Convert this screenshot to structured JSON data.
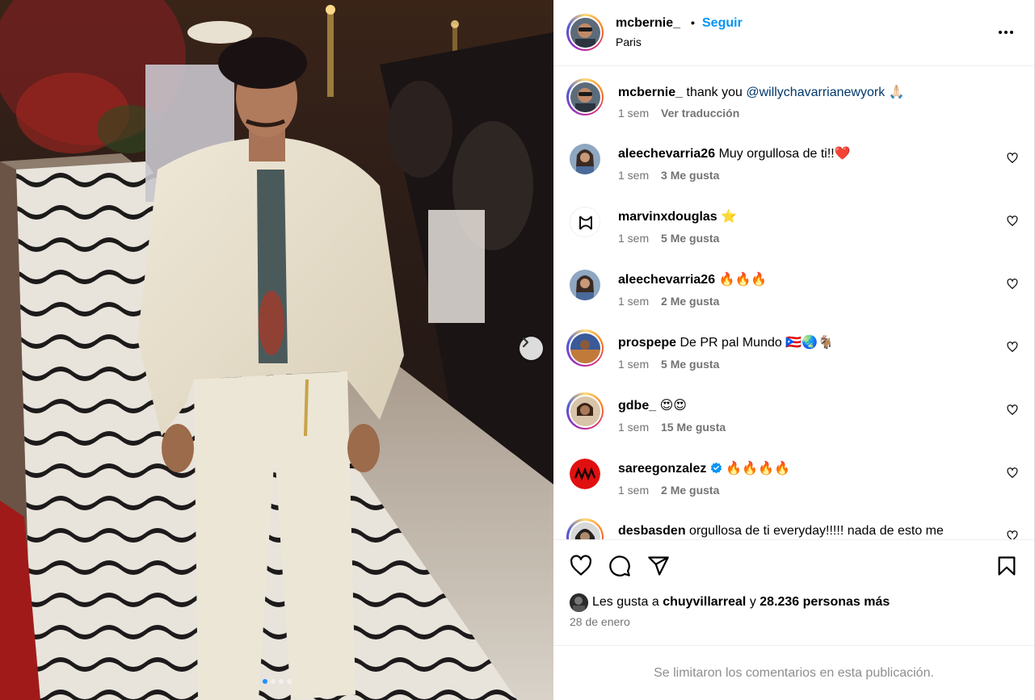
{
  "post": {
    "username": "mcbernie_",
    "separator": "•",
    "follow_label": "Seguir",
    "location": "Paris"
  },
  "caption": {
    "username": "mcbernie_",
    "text": "thank you",
    "mention": "@willychavarrianewyork",
    "emoji": "🙏🏻",
    "time": "1 sem",
    "translate_label": "Ver traducción"
  },
  "comments": [
    {
      "username": "aleechevarria26",
      "text": "Muy orgullosa de ti!!❤️",
      "time": "1 sem",
      "likes": "3 Me gusta",
      "avatar": "woman-portrait"
    },
    {
      "username": "marvinxdouglas",
      "text": "⭐",
      "time": "1 sem",
      "likes": "5 Me gusta",
      "avatar": "logo-mark"
    },
    {
      "username": "aleechevarria26",
      "text": "🔥🔥🔥",
      "time": "1 sem",
      "likes": "2 Me gusta",
      "avatar": "woman-portrait"
    },
    {
      "username": "prospepe",
      "text": "De PR pal Mundo 🇵🇷🌏🐐",
      "time": "1 sem",
      "likes": "5 Me gusta",
      "avatar": "basketball-court"
    },
    {
      "username": "gdbe_",
      "text": "😍😍",
      "time": "1 sem",
      "likes": "15 Me gusta",
      "avatar": "woman-portrait"
    },
    {
      "username": "sareegonzalez",
      "text": "🔥🔥🔥🔥",
      "time": "1 sem",
      "likes": "2 Me gusta",
      "avatar": "red-logo",
      "verified": true
    },
    {
      "username": "desbasden",
      "text": "orgullosa de ti everyday!!!!! nada de esto me",
      "avatar": "woman-portrait"
    }
  ],
  "likes_summary": {
    "prefix": "Les gusta a",
    "user": "chuyvillarreal",
    "connector": "y",
    "others": "28.236 personas más"
  },
  "date": "28 de enero",
  "comments_limited": "Se limitaron los comentarios en esta publicación.",
  "carousel": {
    "total": 4,
    "active": 1
  },
  "icons": [
    "heart-icon",
    "comment-icon",
    "share-icon",
    "bookmark-icon",
    "more-icon",
    "chevron-right-icon",
    "verified-icon"
  ],
  "colors": {
    "link": "#0095f6",
    "mention": "#00376b",
    "muted": "#737373",
    "verified": "#0095f6"
  }
}
